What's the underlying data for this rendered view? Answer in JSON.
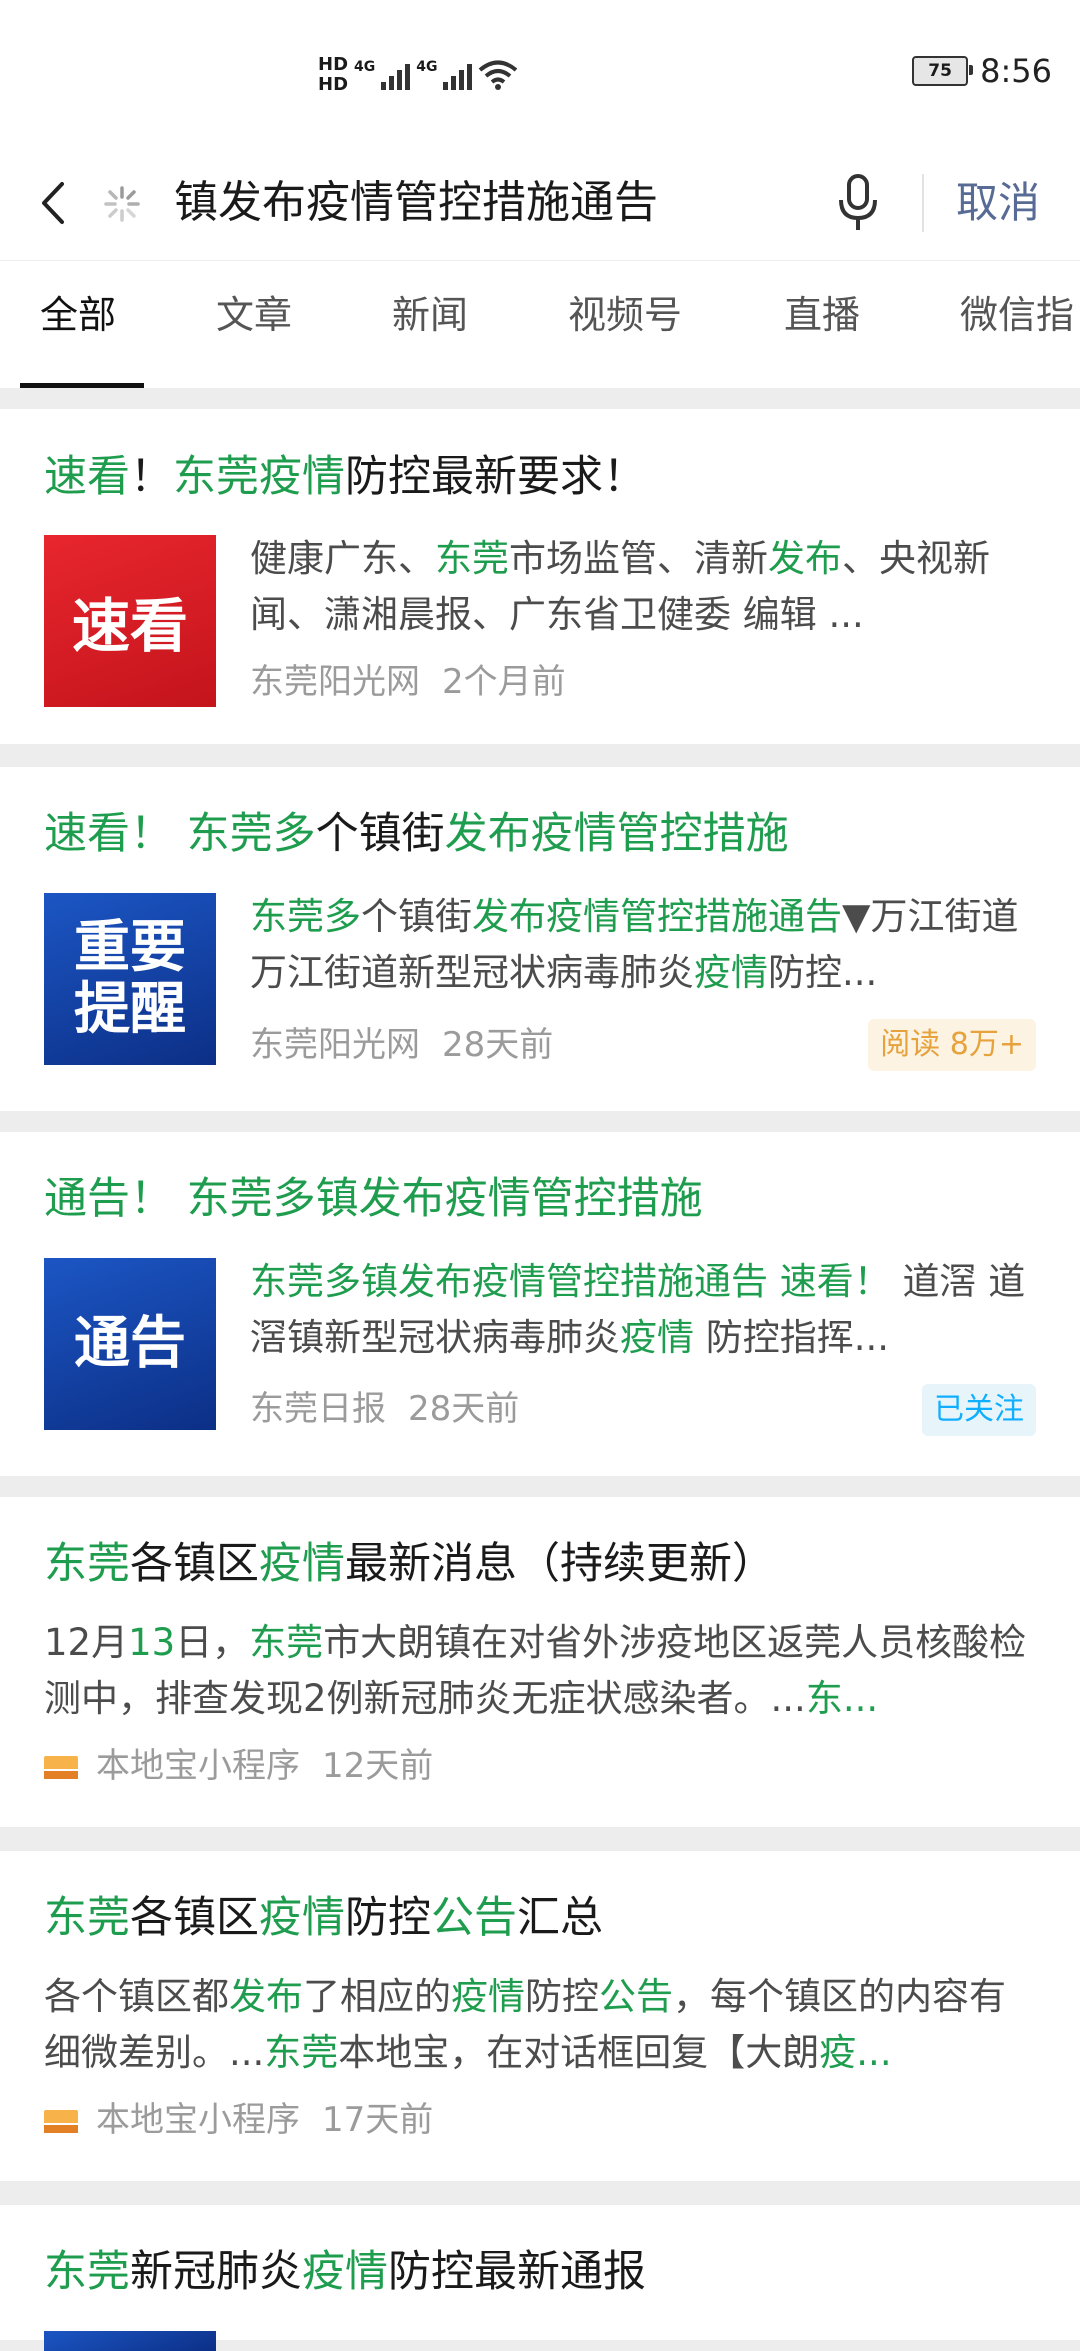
{
  "status_bar": {
    "hd1": "HD",
    "hd2": "HD",
    "net1": "4G",
    "net2": "4G",
    "battery": "75",
    "time": "8:56"
  },
  "search": {
    "query": "镇发布疫情管控措施通告",
    "cancel_label": "取消"
  },
  "tabs": [
    "全部",
    "文章",
    "新闻",
    "视频号",
    "直播",
    "微信指"
  ],
  "results": [
    {
      "title_parts": [
        [
          "速看",
          1
        ],
        [
          "！",
          0
        ],
        [
          "东莞疫情",
          1
        ],
        [
          "防控最新要求！",
          0
        ]
      ],
      "thumb_text": "速看",
      "snippet_parts": [
        [
          "健康广东、",
          0
        ],
        [
          "东莞",
          1
        ],
        [
          "市场监管、清新",
          0
        ],
        [
          "发布",
          1
        ],
        [
          "、央视新闻、潇湘晨报、广东省卫健委 编辑 ...",
          0
        ]
      ],
      "source": "东莞阳光网",
      "time": "2个月前"
    },
    {
      "title_parts": [
        [
          "速看！ 东莞多",
          1
        ],
        [
          "个镇街",
          0
        ],
        [
          "发布疫情管控措施",
          1
        ]
      ],
      "thumb_text": "重要提醒",
      "snippet_parts": [
        [
          "东莞多",
          1
        ],
        [
          "个镇街",
          0
        ],
        [
          "发布疫情管控措施通告",
          1
        ],
        [
          "▼万江街道万江街道新型冠状病毒肺炎",
          0
        ],
        [
          "疫情",
          1
        ],
        [
          "防控...",
          0
        ]
      ],
      "source": "东莞阳光网",
      "time": "28天前",
      "badge": "阅读 8万+"
    },
    {
      "title_parts": [
        [
          "通告！ 东莞多镇发布疫情管控措施",
          1
        ]
      ],
      "thumb_text": "通告",
      "snippet_parts": [
        [
          "东莞多镇发布疫情管控措施通告 速看！",
          1
        ],
        [
          " 道滘 道滘镇新型冠状病毒肺炎",
          0
        ],
        [
          "疫情",
          1
        ],
        [
          " 防控指挥...",
          0
        ]
      ],
      "source": "东莞日报",
      "time": "28天前",
      "badge": "已关注"
    },
    {
      "title_parts": [
        [
          "东莞",
          1
        ],
        [
          "各镇区",
          0
        ],
        [
          "疫情",
          1
        ],
        [
          "最新消息（持续更新）",
          0
        ]
      ],
      "snippet_parts": [
        [
          "12月",
          0
        ],
        [
          "13",
          1
        ],
        [
          "日，",
          0
        ],
        [
          "东莞",
          1
        ],
        [
          "市大朗镇在对省外涉疫地区返莞人员核酸检测中，排查发现2例新冠肺炎无症状感染者。...",
          0
        ],
        [
          "东...",
          1
        ]
      ],
      "source": "本地宝小程序",
      "time": "12天前"
    },
    {
      "title_parts": [
        [
          "东莞",
          1
        ],
        [
          "各镇区",
          0
        ],
        [
          "疫情",
          1
        ],
        [
          "防控",
          0
        ],
        [
          "公告",
          1
        ],
        [
          "汇总",
          0
        ]
      ],
      "snippet_parts": [
        [
          "各个镇区都",
          0
        ],
        [
          "发布",
          1
        ],
        [
          "了相应的",
          0
        ],
        [
          "疫情",
          1
        ],
        [
          "防控",
          0
        ],
        [
          "公告",
          1
        ],
        [
          "，每个镇区的内容有细微差别。...",
          0
        ],
        [
          "东莞",
          1
        ],
        [
          "本地宝，在对话框回复【大朗",
          0
        ],
        [
          "疫...",
          1
        ]
      ],
      "source": "本地宝小程序",
      "time": "17天前"
    },
    {
      "title_parts": [
        [
          "东莞",
          1
        ],
        [
          "新冠肺炎",
          0
        ],
        [
          "疫情",
          1
        ],
        [
          "防控最新通报",
          0
        ]
      ]
    }
  ]
}
